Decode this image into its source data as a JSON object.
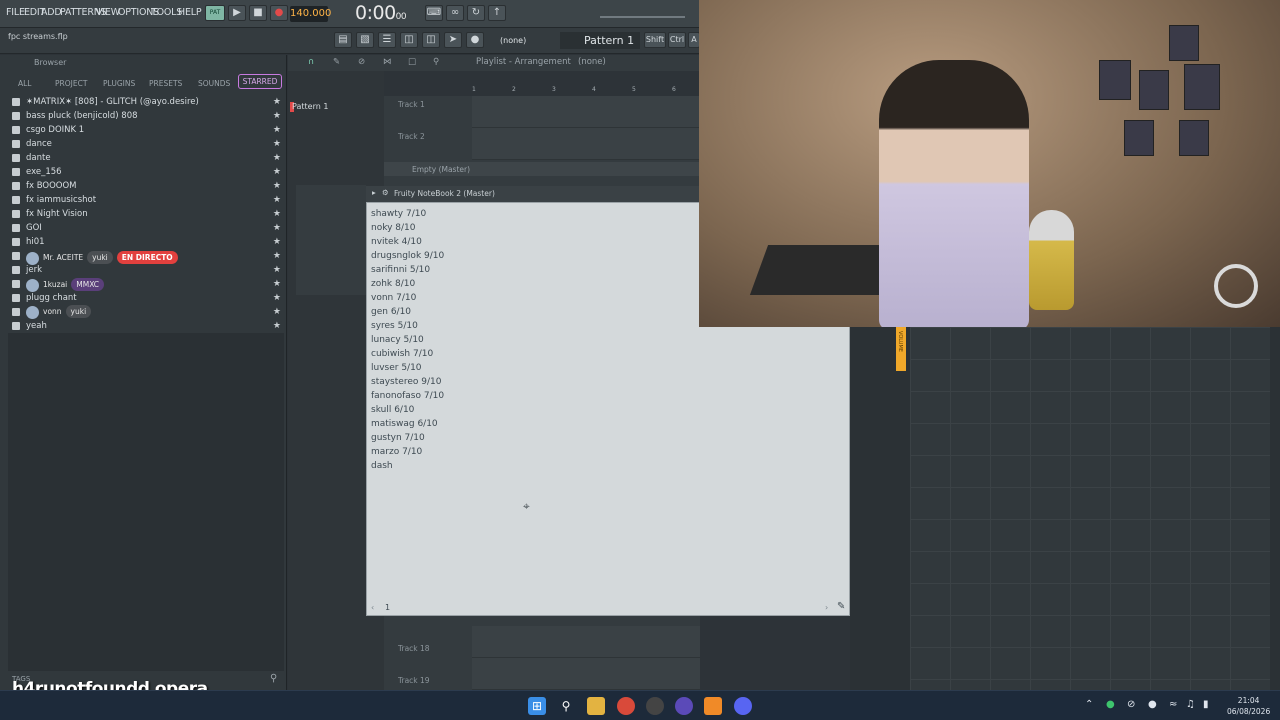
{
  "menu": [
    "FILE",
    "EDIT",
    "ADD",
    "PATTERNS",
    "VIEW",
    "OPTIONS",
    "TOOLS",
    "HELP"
  ],
  "transport": {
    "pat_label": "PAT",
    "tempo": "140.000",
    "time_main": "0:00",
    "time_small": "00"
  },
  "toolbar2": {
    "filepath": "fpc streams.flp",
    "snap": "(none)",
    "pattern": "Pattern 1",
    "shift": "Shift",
    "ctrl": "Ctrl",
    "alt": "A"
  },
  "browser": {
    "title": "Browser",
    "tabs": [
      "ALL",
      "PROJECT",
      "PLUGINS",
      "PRESETS",
      "SOUNDS",
      "STARRED"
    ],
    "items": [
      "✶MATRIX✶ [808] - GLITCH (@ayo.desire)",
      "bass pluck (benjicold) 808",
      "csgo DOINK 1",
      "dance",
      "dante",
      "exe_156",
      "fx BOOOOM",
      "fx iammusicshot",
      "fx Night Vision",
      "GOI",
      "hi01",
      "",
      "jerk",
      "",
      "plugg chant",
      "",
      "yeah"
    ],
    "tags_label": "TAGS"
  },
  "chat": [
    {
      "user": "Mr. ACEITE",
      "badge": "yuki",
      "live": "EN DIRECTO"
    },
    {
      "user": "1kuzai",
      "badge": "MMXC"
    },
    {
      "user": "vonn",
      "badge": "yuki"
    }
  ],
  "playlist": {
    "title": "Playlist - Arrangement",
    "sub": "(none)",
    "pattern_item": "Pattern 1",
    "ruler": [
      "1",
      "2",
      "3",
      "4",
      "5",
      "6"
    ],
    "tracks_top": [
      "Track 1",
      "Track 2"
    ],
    "tracks_bottom": [
      "Track 18",
      "Track 19"
    ],
    "empty_label": "Empty (Master)"
  },
  "notebook": {
    "title": "Fruity NoteBook 2 (Master)",
    "lines": [
      "shawty 7/10",
      "noky 8/10",
      "nvitek 4/10",
      "drugsnglok 9/10",
      "sarifinni 5/10",
      "zohk 8/10",
      "vonn 7/10",
      "gen 6/10",
      "syres 5/10",
      "lunacy 5/10",
      "cubiwish 7/10",
      "luvser 5/10",
      "staystereo 9/10",
      "fanonofaso 7/10",
      "skull 6/10",
      "matiswag 6/10",
      "gustyn 7/10",
      "marzo 7/10",
      "dash"
    ],
    "page": "1"
  },
  "mixer": {
    "volume_label": "VOLUME"
  },
  "overlay": {
    "name": "h4runotfoundd  opera"
  },
  "taskbar": {
    "time": "21:04",
    "date": "06/08/2026"
  },
  "colors": {
    "accent_orange": "#f0a82a",
    "starred": "#c87ae0",
    "live_red": "#e2403e"
  }
}
